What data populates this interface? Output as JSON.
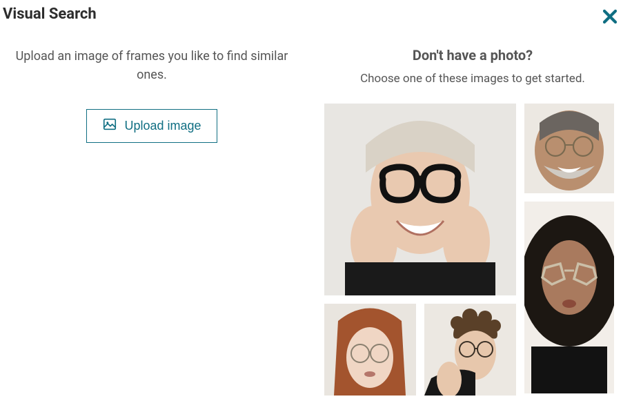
{
  "header": {
    "title": "Visual Search",
    "close_icon": "close-icon"
  },
  "left": {
    "instructions": "Upload an image of frames you like to find similar ones.",
    "upload_button_label": "Upload image"
  },
  "right": {
    "heading": "Don't have a photo?",
    "subheading": "Choose one of these images to get started.",
    "samples": [
      {
        "name": "sample-image-1",
        "alt": "Woman with black cat-eye glasses smiling with hands on cheeks"
      },
      {
        "name": "sample-image-2",
        "alt": "Man with gray beard wearing thin round glasses smiling"
      },
      {
        "name": "sample-image-3",
        "alt": "Woman with curly black hair wearing geometric beige glasses"
      },
      {
        "name": "sample-image-4",
        "alt": "Woman with red hair wearing round wire glasses"
      },
      {
        "name": "sample-image-5",
        "alt": "Man with curly brown hair wearing round glasses"
      }
    ]
  },
  "colors": {
    "accent": "#0f6e82",
    "text_muted": "#555555"
  }
}
